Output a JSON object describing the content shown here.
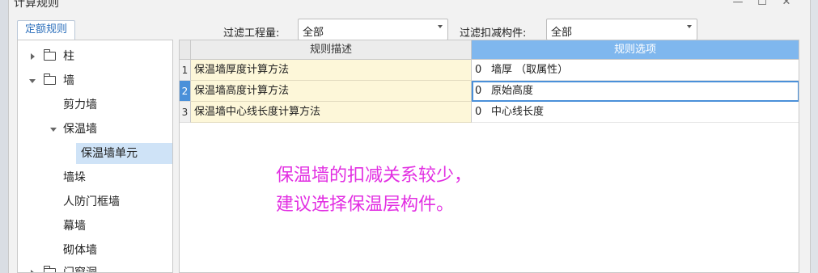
{
  "window": {
    "title": "计算规则",
    "minimize_label": "—",
    "maximize_label": "☐",
    "close_label": "✕"
  },
  "tab": {
    "label": "定额规则"
  },
  "filters": {
    "quantity": {
      "label": "过滤工程量:",
      "value": "全部"
    },
    "deduction": {
      "label": "过滤扣减构件:",
      "value": "全部"
    }
  },
  "tree": {
    "items": [
      {
        "label": "柱"
      },
      {
        "label": "墙"
      },
      {
        "label": "剪力墙"
      },
      {
        "label": "保温墙"
      },
      {
        "label": "保温墙单元"
      },
      {
        "label": "墙垛"
      },
      {
        "label": "人防门框墙"
      },
      {
        "label": "幕墙"
      },
      {
        "label": "砌体墙"
      },
      {
        "label": "门窗洞"
      }
    ]
  },
  "grid": {
    "columns": [
      "规则描述",
      "规则选项"
    ],
    "rows": [
      {
        "num": "1",
        "desc": "保温墙厚度计算方法",
        "code": "0",
        "option": "墙厚 （取属性）"
      },
      {
        "num": "2",
        "desc": "保温墙高度计算方法",
        "code": "0",
        "option": "原始高度"
      },
      {
        "num": "3",
        "desc": "保温墙中心线长度计算方法",
        "code": "0",
        "option": "中心线长度"
      }
    ]
  },
  "annotation": {
    "line1": "保温墙的扣减关系较少，",
    "line2": "建议选择保温层构件。"
  },
  "colors": {
    "accent": "#4a90d9",
    "header_selected": "#7fb7ee",
    "annotation": "#e22fe2"
  }
}
